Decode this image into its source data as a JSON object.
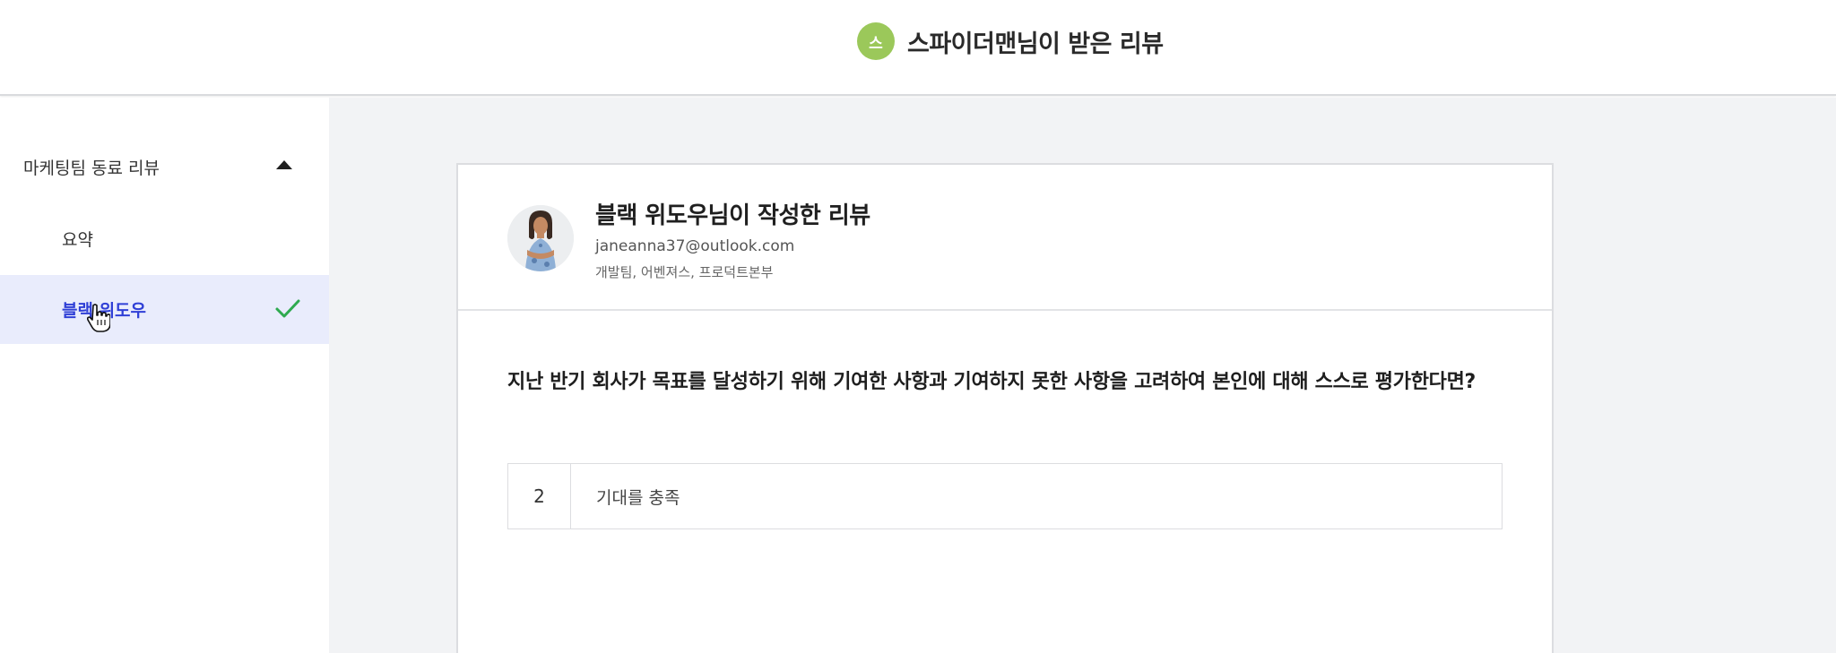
{
  "header": {
    "avatar_initial": "스",
    "title": "스파이더맨님이 받은 리뷰",
    "avatar_color": "#9bc85a"
  },
  "sidebar": {
    "group_label": "마케팅팀 동료 리뷰",
    "group_icon": "caret-up-icon",
    "items": [
      {
        "label": "요약",
        "active": false
      },
      {
        "label": "블랙 위도우",
        "active": true,
        "icon": "check-icon"
      }
    ],
    "active_color": "#2f3fd6",
    "check_color": "#2eaa4f"
  },
  "review": {
    "title": "블랙 위도우님이 작성한 리뷰",
    "email": "janeanna37@outlook.com",
    "teams": "개발팀, 어벤져스, 프로덕트본부",
    "question": "지난 반기 회사가 목표를 달성하기 위해 기여한 사항과 기여하지 못한 사항을 고려하여 본인에 대해 스스로 평가한다면?",
    "answer": {
      "score": "2",
      "text": "기대를 충족"
    }
  }
}
